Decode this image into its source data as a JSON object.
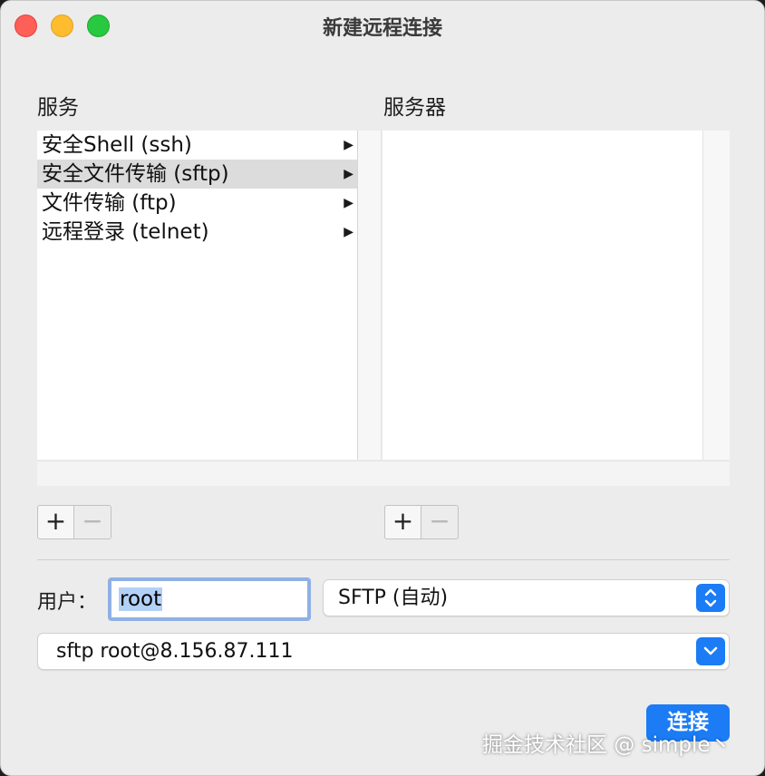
{
  "window": {
    "title": "新建远程连接"
  },
  "services": {
    "header": "服务",
    "items": [
      {
        "label": "安全Shell (ssh)",
        "selected": false
      },
      {
        "label": "安全文件传输 (sftp)",
        "selected": true
      },
      {
        "label": "文件传输 (ftp)",
        "selected": false
      },
      {
        "label": "远程登录 (telnet)",
        "selected": false
      }
    ],
    "add_label": "+",
    "remove_label": "−"
  },
  "servers": {
    "header": "服务器",
    "items": [],
    "add_label": "+",
    "remove_label": "−"
  },
  "user": {
    "label": "用户：",
    "value": "root"
  },
  "protocol": {
    "selected": "SFTP (自动)"
  },
  "command": {
    "selected": "sftp root@8.156.87.111"
  },
  "connect_button": {
    "label": "连接"
  },
  "watermark": {
    "text": "掘金技术社区 @ simple丶"
  },
  "colors": {
    "accent": "#1b7cf5",
    "close": "#fe5f57",
    "minimize": "#febc2e",
    "maximize": "#28c840",
    "focus_ring": "#8fb0e4",
    "selection": "#dcdcdc"
  }
}
